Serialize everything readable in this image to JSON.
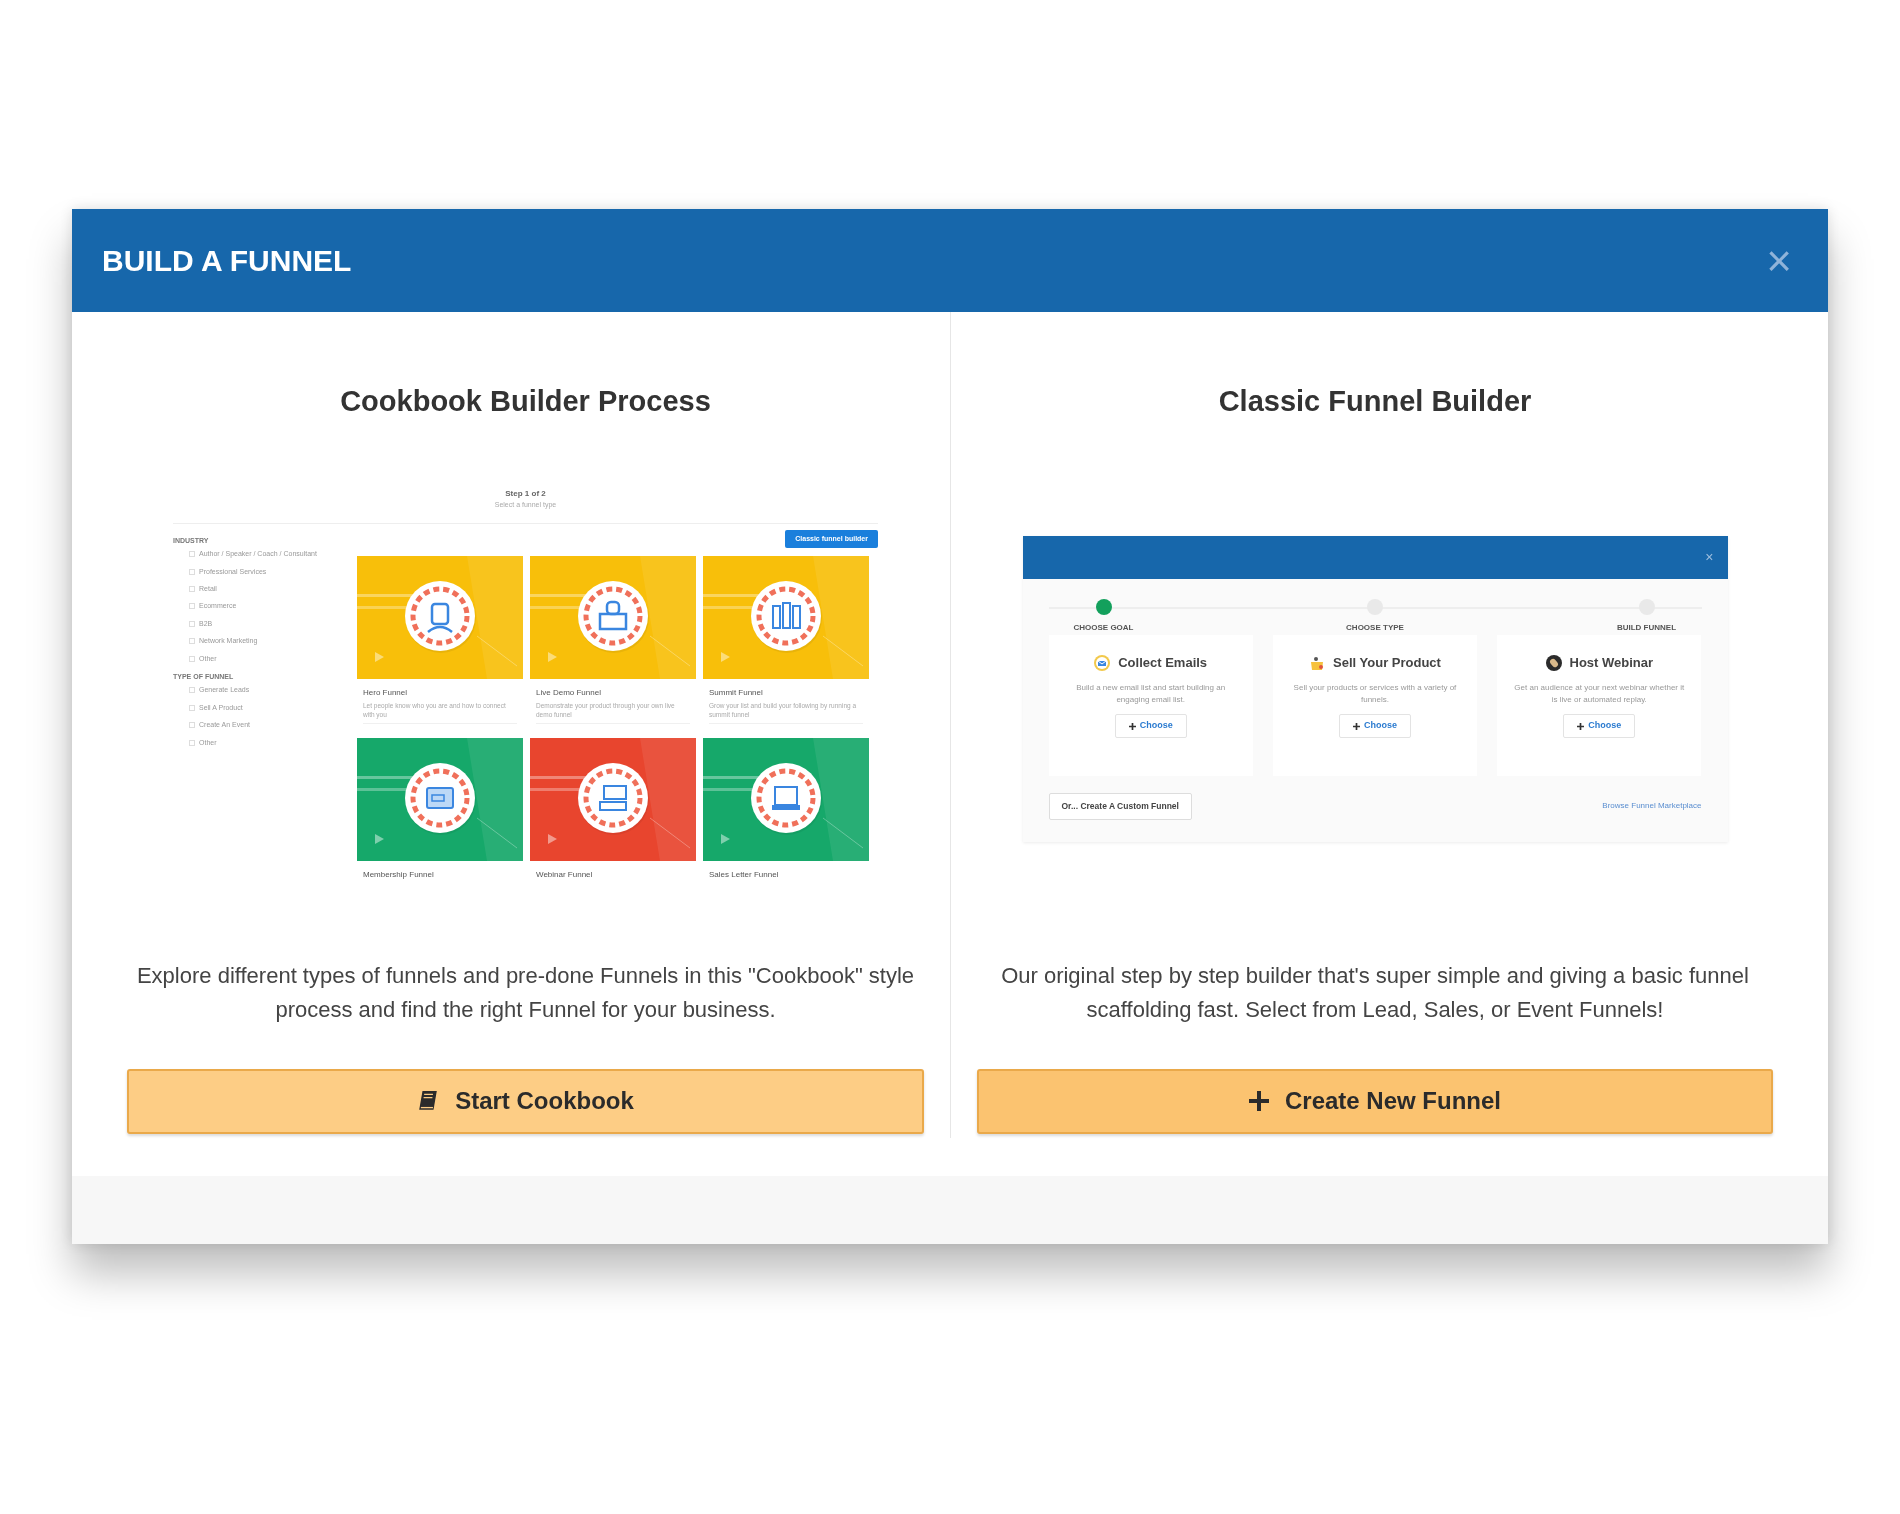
{
  "modal": {
    "title": "BUILD A FUNNEL",
    "close": "×"
  },
  "options": [
    {
      "kind": "cookbook",
      "heading": "Cookbook Builder Process",
      "preview": {
        "step_title": "Step 1 of 2",
        "step_subtitle": "Select a funnel type",
        "classic_button": "Classic funnel builder",
        "filter_groups": [
          {
            "heading": "INDUSTRY",
            "items": [
              {
                "label": "Author / Speaker / Coach / Consultant",
                "checked": false
              },
              {
                "label": "Professional Services",
                "checked": false
              },
              {
                "label": "Retail",
                "checked": false
              },
              {
                "label": "Ecommerce",
                "checked": false
              },
              {
                "label": "B2B",
                "checked": false
              },
              {
                "label": "Network Marketing",
                "checked": false
              },
              {
                "label": "Other",
                "checked": false
              }
            ]
          },
          {
            "heading": "TYPE OF FUNNEL",
            "items": [
              {
                "label": "Generate Leads",
                "checked": false
              },
              {
                "label": "Sell A Product",
                "checked": false
              },
              {
                "label": "Create An Event",
                "checked": false
              },
              {
                "label": "Other",
                "checked": false
              }
            ]
          }
        ],
        "funnels": [
          {
            "name": "Hero Funnel",
            "description": "Let people know who you are and how to connect with you",
            "color": "#f8bf0a"
          },
          {
            "name": "Live Demo Funnel",
            "description": "Demonstrate your product through your own live demo funnel",
            "color": "#f8bf0a"
          },
          {
            "name": "Summit Funnel",
            "description": "Grow your list and build your following by running a summit funnel",
            "color": "#f8bf0a"
          },
          {
            "name": "Membership Funnel",
            "color": "#16a86a"
          },
          {
            "name": "Webinar Funnel",
            "color": "#e8452e"
          },
          {
            "name": "Sales Letter Funnel",
            "color": "#16a86a"
          }
        ]
      },
      "description": "Explore different types of funnels and pre-done Funnels in this \"Cookbook\" style process and find the right Funnel for your business.",
      "button": "Start Cookbook"
    },
    {
      "kind": "classic",
      "heading": "Classic Funnel Builder",
      "preview": {
        "close": "×",
        "steps": [
          {
            "label": "CHOOSE GOAL",
            "done": true
          },
          {
            "label": "CHOOSE TYPE",
            "done": false
          },
          {
            "label": "BUILD FUNNEL",
            "done": false
          }
        ],
        "goals": [
          {
            "kind": "email",
            "title": "Collect Emails",
            "description": "Build a new email list and start building an engaging email list.",
            "button": "Choose"
          },
          {
            "kind": "product",
            "title": "Sell Your Product",
            "description": "Sell your products or services with a variety of funnels.",
            "button": "Choose"
          },
          {
            "kind": "webinar",
            "title": "Host Webinar",
            "description": "Get an audience at your next webinar whether it is live or automated replay.",
            "button": "Choose"
          }
        ],
        "custom_button": "Or... Create A Custom Funnel",
        "marketplace_link": "Browse Funnel Marketplace"
      },
      "description": "Our original step by step builder that's super simple and giving a basic funnel scaffolding fast. Select from Lead, Sales, or Event Funnels!",
      "button": "Create New Funnel"
    }
  ]
}
